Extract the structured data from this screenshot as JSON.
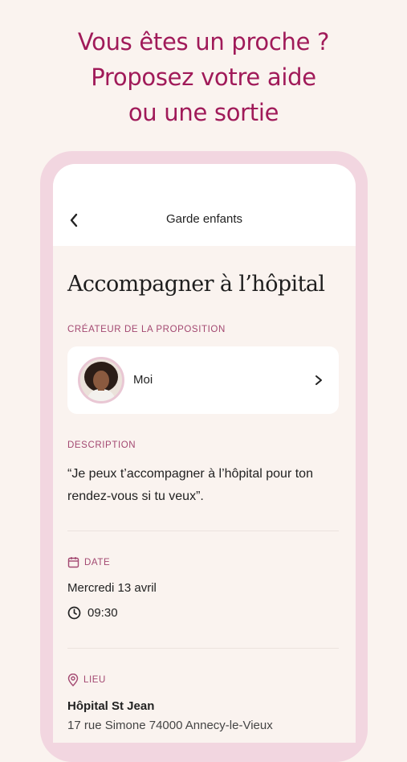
{
  "headline": {
    "line1": "Vous êtes un proche ?",
    "line2": "Proposez votre aide",
    "line3": "ou une sortie"
  },
  "nav": {
    "back_icon": "chevron-left-icon",
    "title": "Garde enfants"
  },
  "page": {
    "title": "Accompagner à l’hôpital"
  },
  "creator": {
    "label": "CRÉATEUR DE LA PROPOSITION",
    "name": "Moi",
    "chevron_icon": "chevron-right-icon"
  },
  "description": {
    "label": "DESCRIPTION",
    "text": "“Je peux t’accompagner à l’hôpital pour ton rendez-vous si tu veux”."
  },
  "date": {
    "icon": "calendar-icon",
    "label": "DATE",
    "value": "Mercredi 13 avril",
    "time_icon": "clock-icon",
    "time": "09:30"
  },
  "place": {
    "icon": "location-pin-icon",
    "label": "LIEU",
    "name": "Hôpital St Jean",
    "address": "17 rue Simone 74000 Annecy-le-Vieux"
  },
  "colors": {
    "accent": "#a01a59",
    "label": "#a34871",
    "frame": "#f2d6e0",
    "background": "#faf3ef"
  }
}
